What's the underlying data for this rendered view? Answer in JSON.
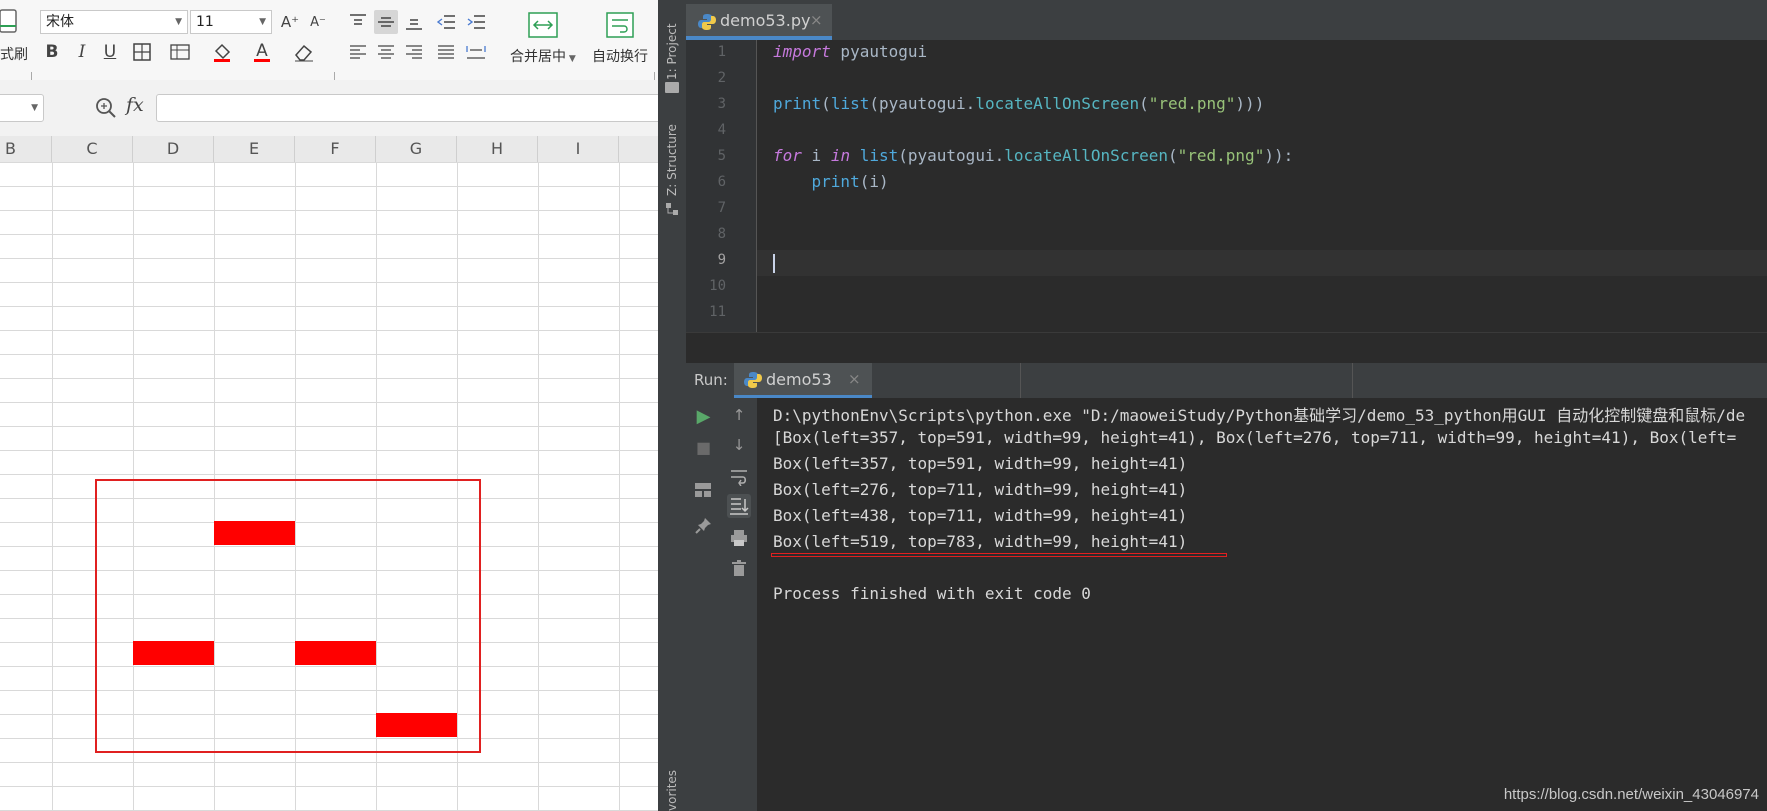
{
  "spreadsheet": {
    "ribbon": {
      "format_painter_label": "式刷",
      "font_name": "宋体",
      "font_size": "11",
      "merge_center_label": "合并居中",
      "wrap_text_label": "自动换行",
      "bold_icon_text": "B",
      "italic_icon_text": "I",
      "underline_icon_text": "U",
      "increase_font_icon_text": "A⁺",
      "decrease_font_icon_text": "A⁻",
      "font_color_icon_text": "A",
      "fx_label": "fx"
    },
    "name_box_value": "",
    "formula_value": "",
    "columns": [
      "B",
      "C",
      "D",
      "E",
      "F",
      "G",
      "H",
      "I"
    ],
    "accent_red": "#ff0000"
  },
  "ide": {
    "project_tab_label": "1: Project",
    "structure_tab_label": "Z: Structure",
    "favorites_tab_label": "vorites",
    "editor_tab": {
      "filename": "demo53.py",
      "close": "×"
    },
    "line_numbers": [
      "1",
      "2",
      "3",
      "4",
      "5",
      "6",
      "7",
      "8",
      "9",
      "10",
      "11"
    ],
    "code": {
      "line1": {
        "kw": "import",
        "rest": " pyautogui"
      },
      "line3": {
        "fn1": "print",
        "p1": "(",
        "fn2": "list",
        "p2": "(pyautogui.",
        "fn3": "locateAllOnScreen",
        "p3": "(",
        "str": "\"red.png\"",
        "p4": ")))"
      },
      "line5": {
        "kw1": "for",
        "p1": " i ",
        "kw2": "in",
        "p2": " ",
        "fn1": "list",
        "p3": "(pyautogui.",
        "fn2": "locateAllOnScreen",
        "p4": "(",
        "str": "\"red.png\"",
        "p5": ")):"
      },
      "line6": {
        "indent": "    ",
        "fn": "print",
        "rest": "(i)"
      }
    },
    "run": {
      "label": "Run:",
      "tab_name": "demo53",
      "close": "×"
    },
    "console_lines": [
      "D:\\pythonEnv\\Scripts\\python.exe \"D:/maoweiStudy/Python基础学习/demo_53_python用GUI 自动化控制键盘和鼠标/de",
      "[Box(left=357, top=591, width=99, height=41), Box(left=276, top=711, width=99, height=41), Box(left=",
      "Box(left=357, top=591, width=99, height=41)",
      "Box(left=276, top=711, width=99, height=41)",
      "Box(left=438, top=711, width=99, height=41)",
      "Box(left=519, top=783, width=99, height=41)",
      "",
      "Process finished with exit code 0"
    ],
    "colors": {
      "editor_bg": "#2b2b2b",
      "panel_bg": "#3c3f41",
      "tab_underline": "#4a88c7",
      "underline_red": "#e02020"
    }
  },
  "watermark": "https://blog.csdn.net/weixin_43046974"
}
